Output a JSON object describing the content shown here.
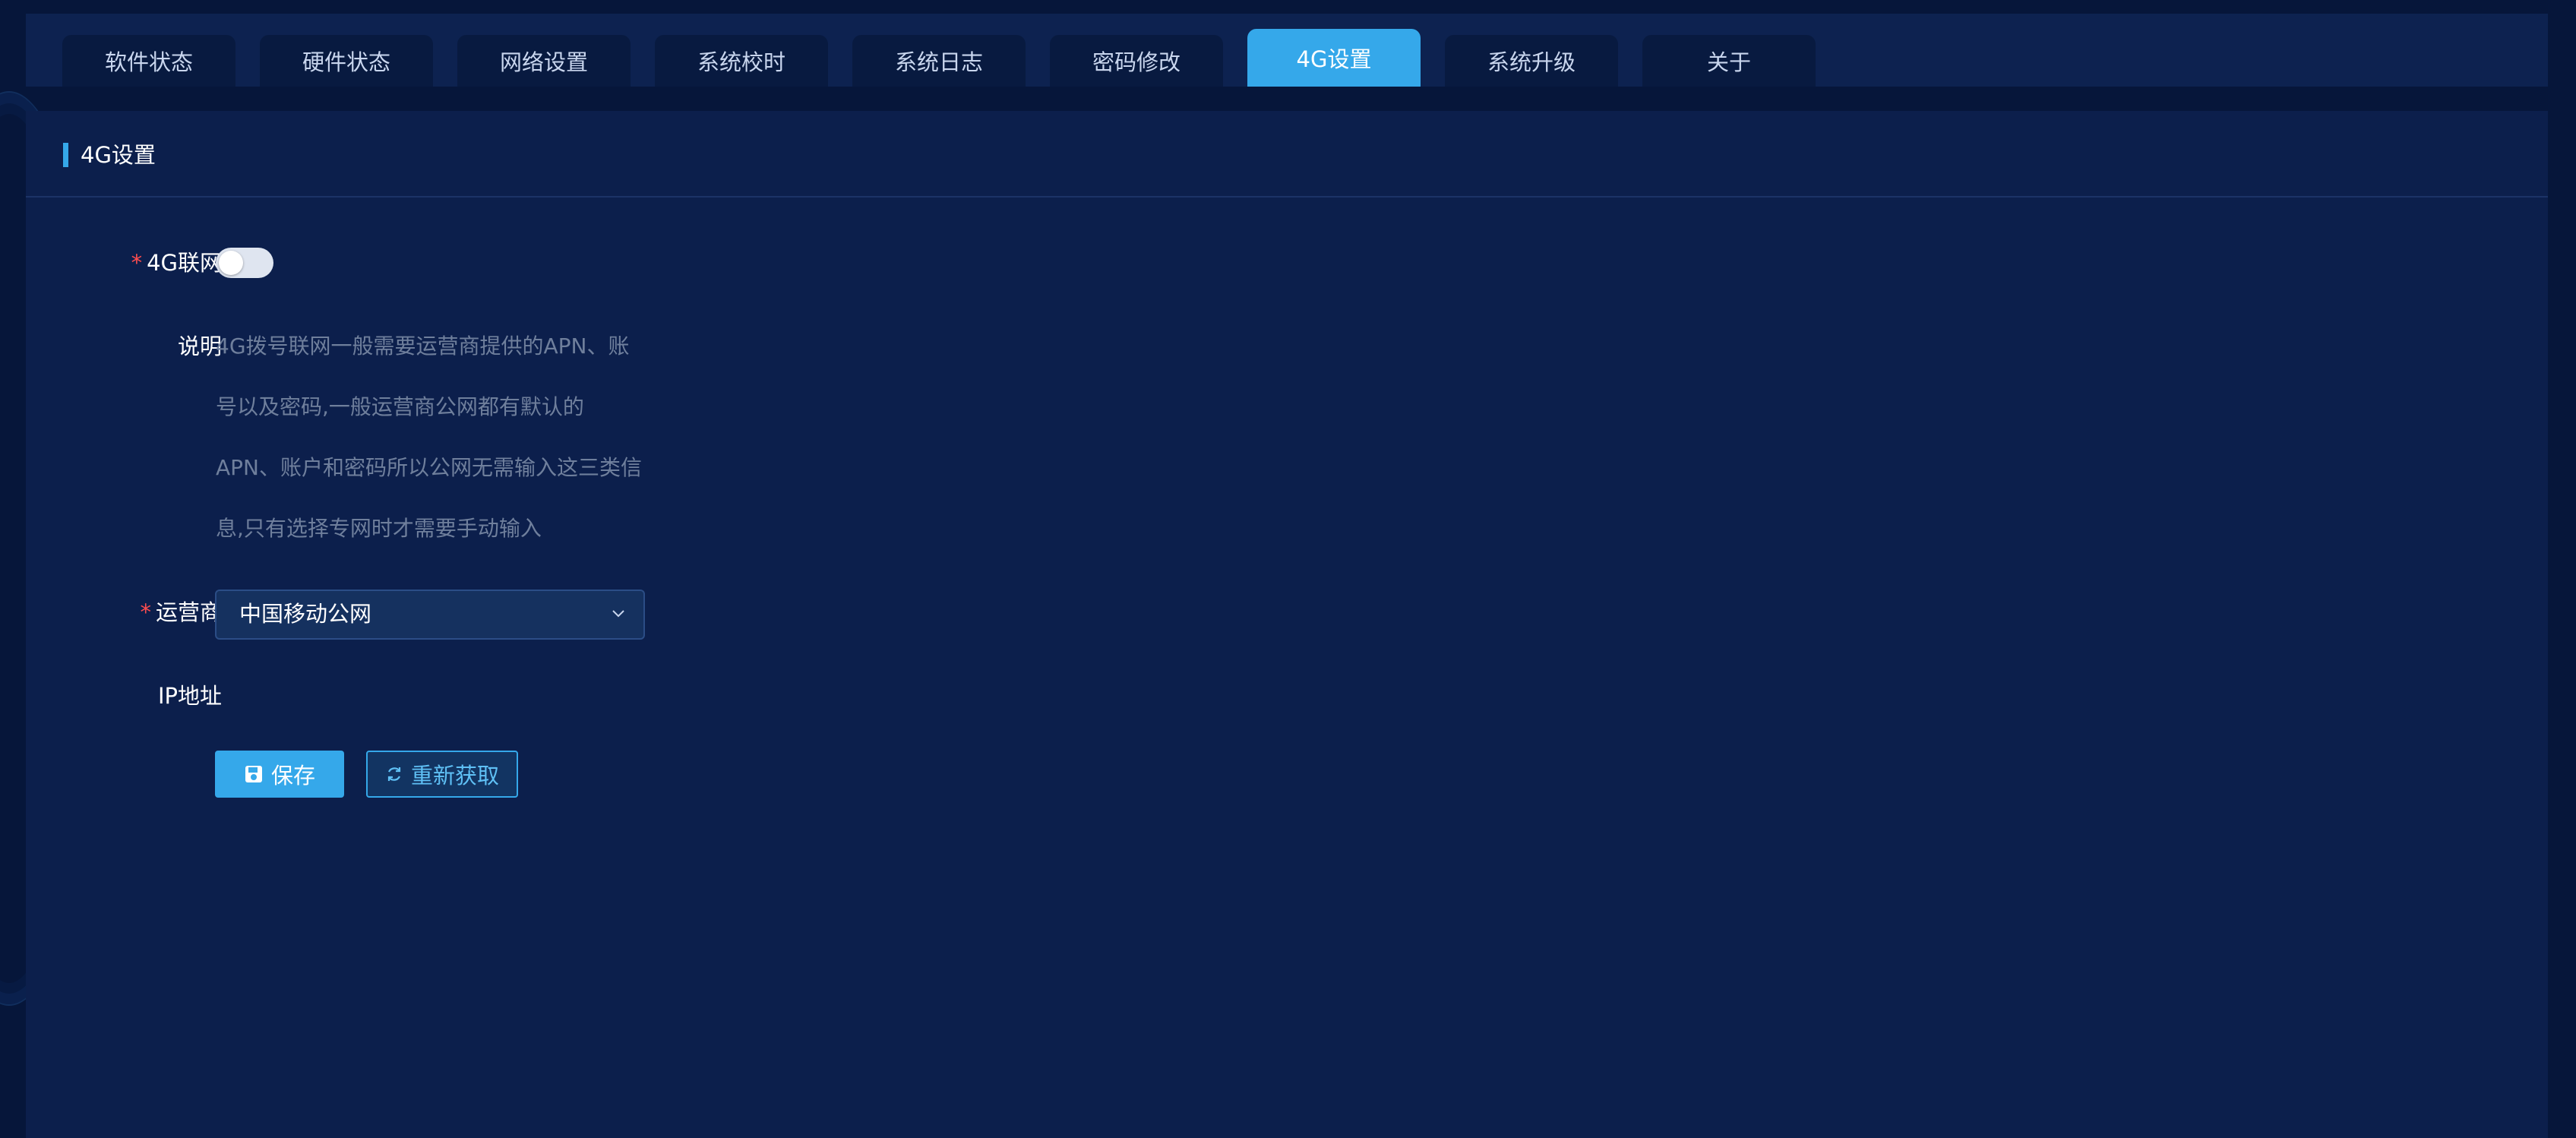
{
  "tabs": [
    {
      "label": "软件状态",
      "active": false
    },
    {
      "label": "硬件状态",
      "active": false
    },
    {
      "label": "网络设置",
      "active": false
    },
    {
      "label": "系统校时",
      "active": false
    },
    {
      "label": "系统日志",
      "active": false
    },
    {
      "label": "密码修改",
      "active": false
    },
    {
      "label": "4G设置",
      "active": true
    },
    {
      "label": "系统升级",
      "active": false
    },
    {
      "label": "关于",
      "active": false
    }
  ],
  "panel": {
    "title": "4G设置"
  },
  "form": {
    "required_mark": "*",
    "net_label": "4G联网",
    "net_enabled": false,
    "desc_label": "说明",
    "desc_lines": [
      "4G拨号联网一般需要运营商提供的APN、账",
      "号以及密码,一般运营商公网都有默认的",
      "APN、账户和密码所以公网无需输入这三类信",
      "息,只有选择专网时才需要手动输入"
    ],
    "carrier_label": "运营商",
    "carrier_value": "中国移动公网",
    "ip_label": "IP地址",
    "ip_value": ""
  },
  "buttons": {
    "save_label": "保存",
    "refresh_label": "重新获取"
  },
  "colors": {
    "accent": "#35a8ea",
    "background": "#06163a",
    "panel": "#0c1f4c",
    "required": "#ff4d4f"
  },
  "icons": {
    "save": "save-icon",
    "refresh": "refresh-icon",
    "dropdown": "chevron-down-icon"
  }
}
